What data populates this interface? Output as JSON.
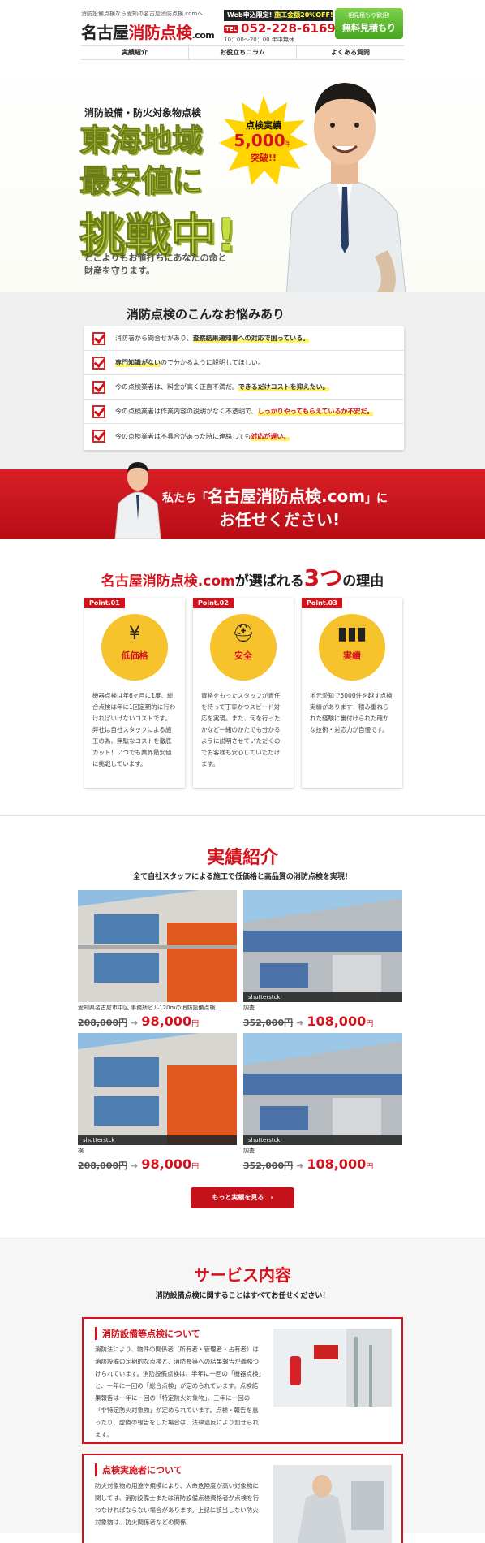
{
  "header": {
    "tagline": "消防設備点検なら愛知の名古屋消防点検.comへ",
    "logo_a": "名古屋",
    "logo_b": "消防点検",
    "logo_c": ".com",
    "web_banner_a": "Web申込限定!",
    "web_banner_b": "施工金額20%OFF!",
    "tel_prefix": "TEL",
    "tel": "052-228-6169",
    "hours": "10：00〜20：00 年中無休",
    "cta_small": "相見積もり歓迎!",
    "cta_big": "無料見積もり"
  },
  "nav": [
    "実績紹介",
    "お役立ちコラム",
    "よくある質問"
  ],
  "hero": {
    "sub": "消防設備・防火対象物点検",
    "line1": "東海地域",
    "line2": "最安値に",
    "line3": "挑戦中!",
    "desc1": "どこよりもお値打ちにあなたの命と",
    "desc2": "財産を守ります。",
    "burst1": "点検実績",
    "burst2": "5,000",
    "burst3": "件",
    "burst4": "突破!!"
  },
  "worries": {
    "title": "消防点検のこんなお悩みあり",
    "items": [
      {
        "a": "消防署から問合せがあり、",
        "b": "査察結果通知書への対応で困っている。",
        "c": ""
      },
      {
        "a": "",
        "b": "専門知識がない",
        "c": "ので分かるように説明してほしい。"
      },
      {
        "a": "今の点検業者は、料金が高く正直不満だ。",
        "b": "できるだけコストを抑えたい。",
        "c": ""
      },
      {
        "a": "今の点検業者は作業内容の説明がなく不透明で、",
        "b": "しっかりやってもらえているか不安だ。",
        "c": ""
      },
      {
        "a": "今の点検業者は不具合があった時に連絡しても",
        "b": "対応が遅い。",
        "c": ""
      }
    ]
  },
  "band": {
    "line1a": "私たち「",
    "line1b": "名古屋消防点検.com",
    "line1c": "」に",
    "line2": "お任せください!"
  },
  "reasons": {
    "title_a": "名古屋消防点検.com",
    "title_b": "が選ばれる",
    "title_num": "3つ",
    "title_c": "の理由",
    "cards": [
      {
        "point": "Point.01",
        "icon": "¥",
        "label": "低価格",
        "text": "機器点検は年6ヶ月に1度、総合点検は年に1回定期的に行わければいけないコストです。弊社は自社スタッフによる施工の為、無駄なコストを徹底カット！いつでも業界最安値に挑戦しています。"
      },
      {
        "point": "Point.02",
        "icon": "⛑",
        "label": "安全",
        "text": "資格をもったスタッフが責任を持って丁寧かつスピード対応を実現。また、何を行ったかなど一緒のかたでも分かるように説明させていただくのでお客様も安心していただけます。"
      },
      {
        "point": "Point.03",
        "icon": "▮▮▮",
        "label": "実績",
        "text": "地元愛知で5000件を越す点検実績があります！積み重ねられた経験に裏付けられた確かな技術・対応力が自慢です。"
      }
    ]
  },
  "works": {
    "title": "実績紹介",
    "sub": "全て自社スタッフによる施工で低価格と高品質の消防点検を実現！",
    "items": [
      {
        "cap": "愛知県名古屋市中区 事務所ビル120mの消防設備点検",
        "old": "208,000円",
        "new": "98,000",
        "yen": "円",
        "wm": ""
      },
      {
        "cap": "調査",
        "old": "352,000円",
        "new": "108,000",
        "yen": "円",
        "wm": "shutterstck"
      },
      {
        "cap": "検",
        "old": "208,000円",
        "new": "98,000",
        "yen": "円",
        "wm": "shutterstck"
      },
      {
        "cap": "調査",
        "old": "352,000円",
        "new": "108,000",
        "yen": "円",
        "wm": "shutterstck"
      }
    ],
    "more": "もっと実績を見る　›"
  },
  "services": {
    "title": "サービス内容",
    "sub": "消防設備点検に関することはすべてお任せください！",
    "items": [
      {
        "h": "消防設備等点検について",
        "p": "消防法により、物件の関係者（所有者・管理者・占有者）は消防設備の定期的な点検と、消防長等への結果報告が義務づけられています。消防設備点検は、半年に一回の「機器点検」と、一年に一回の「総合点検」が定められています。点検結果報告は一年に一回の「特定防火対象物」、三年に一回の「非特定防火対象物」が定められています。点検・報告を怠ったり、虚偽の報告をした場合は、法律違反により罰せられます。"
      },
      {
        "h": "点検実施者について",
        "p": "防火対象物の用途や規模により、人命危険度が高い対象物に関しては、消防設備士または消防設備点検資格者が点検を行わなければならない場合があります。上記に該当しない防火対象物は、防火関係者などの関係"
      }
    ]
  },
  "colors": {
    "accent": "#d3121b",
    "green": "#c7df3e",
    "gold": "#f7c32d"
  }
}
